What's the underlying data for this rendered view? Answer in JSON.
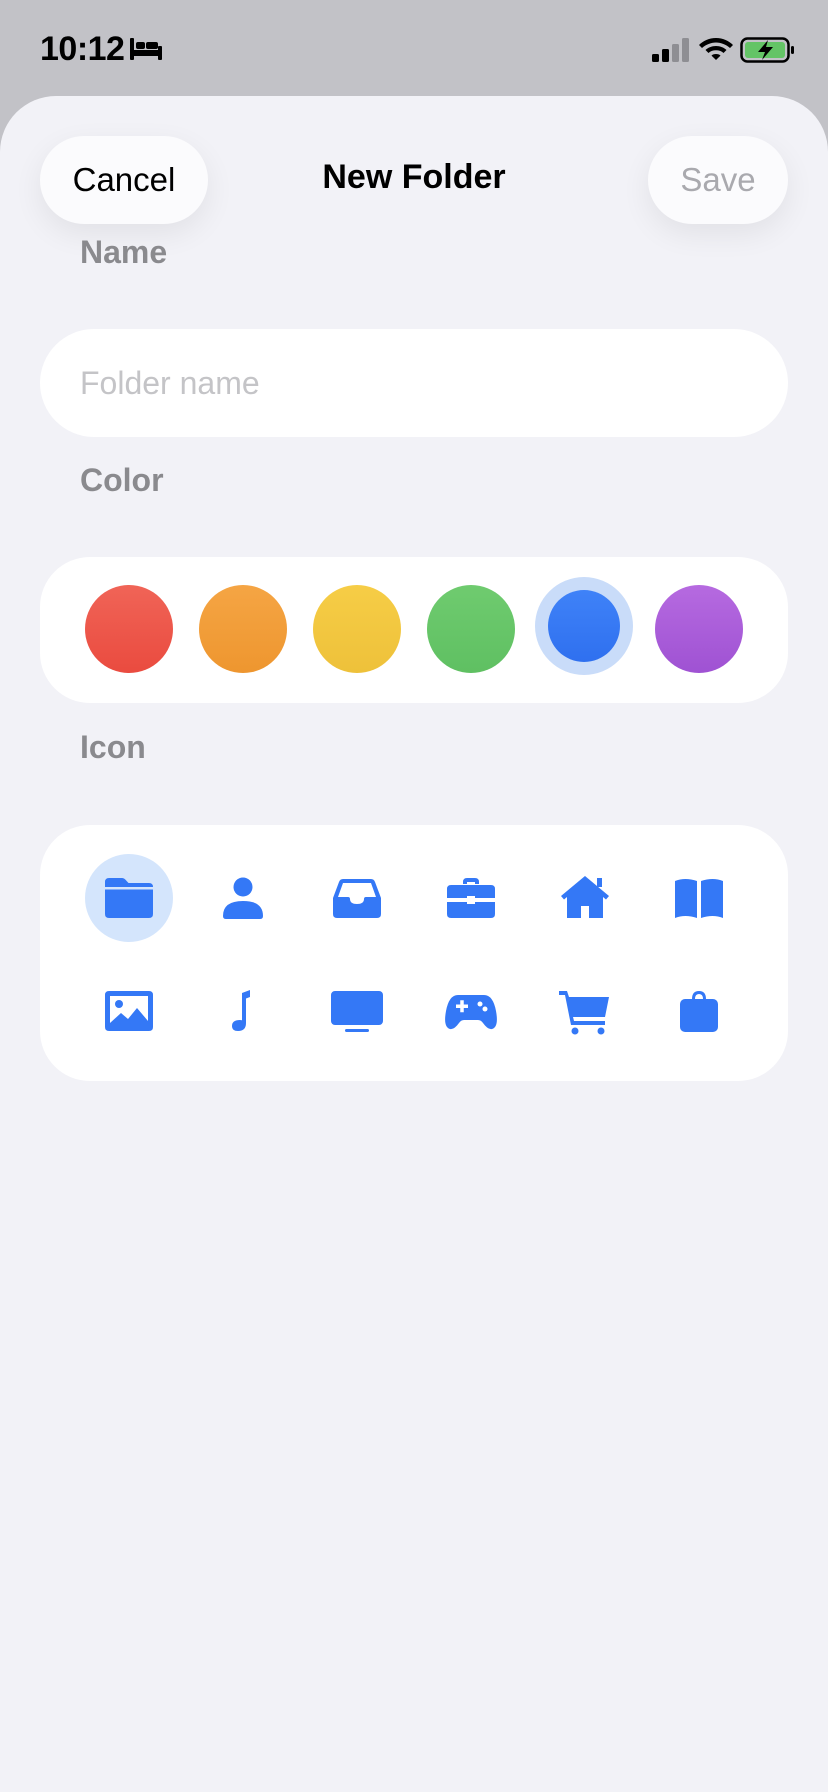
{
  "status_bar": {
    "time": "10:12",
    "icons": [
      "bed-icon",
      "signal-icon",
      "wifi-icon",
      "battery-charging-icon"
    ]
  },
  "header": {
    "cancel_label": "Cancel",
    "title": "New Folder",
    "save_label": "Save"
  },
  "name_section": {
    "label": "Name",
    "placeholder": "Folder name",
    "value": ""
  },
  "color_section": {
    "label": "Color",
    "selected": "blue",
    "colors": [
      {
        "name": "red",
        "hex": "#ed4f45"
      },
      {
        "name": "orange",
        "hex": "#f29b35"
      },
      {
        "name": "yellow",
        "hex": "#f2c53c"
      },
      {
        "name": "green",
        "hex": "#64c466"
      },
      {
        "name": "blue",
        "hex": "#3478f6"
      },
      {
        "name": "purple",
        "hex": "#a95bd9"
      }
    ]
  },
  "icon_section": {
    "label": "Icon",
    "selected": "folder-icon",
    "icons": [
      "folder-icon",
      "person-icon",
      "tray-icon",
      "briefcase-icon",
      "house-icon",
      "book-icon",
      "photo-icon",
      "music-note-icon",
      "display-icon",
      "gamecontroller-icon",
      "cart-icon",
      "bag-icon"
    ]
  },
  "accent_color": "#3478f6"
}
